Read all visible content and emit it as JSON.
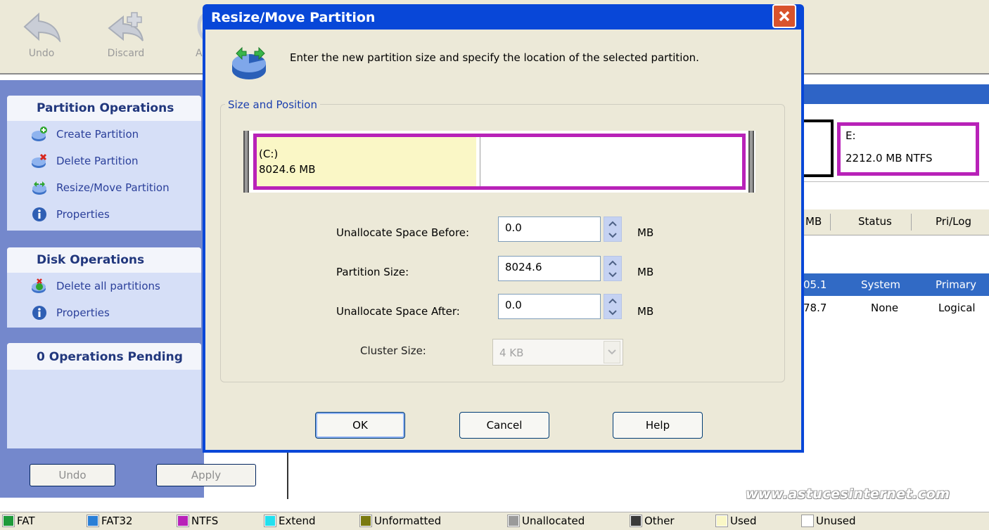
{
  "toolbar": {
    "undo": "Undo",
    "discard": "Discard",
    "apply_partial": "A"
  },
  "left_pane": {
    "partition_ops": {
      "title": "Partition Operations",
      "items": [
        "Create Partition",
        "Delete Partition",
        "Resize/Move Partition",
        "Properties"
      ]
    },
    "disk_ops": {
      "title": "Disk Operations",
      "items": [
        "Delete all partitions",
        "Properties"
      ]
    },
    "pending": {
      "title": "0 Operations Pending"
    },
    "undo_button": "Undo",
    "apply_button": "Apply"
  },
  "background_app": {
    "disk_e": {
      "letter": "E:",
      "info": "2212.0 MB  NTFS"
    },
    "columns": {
      "mb": "MB",
      "status": "Status",
      "prilog": "Pri/Log"
    },
    "rows": [
      {
        "size": "05.1",
        "status": "System",
        "type": "Primary"
      },
      {
        "size": "78.7",
        "status": "None",
        "type": "Logical"
      }
    ],
    "watermark": "www.astucesinternet.com"
  },
  "dialog": {
    "title": "Resize/Move Partition",
    "description": "Enter the new partition size and specify the location of the selected partition.",
    "group_label": "Size and Position",
    "partition": {
      "name": "(C:)",
      "size": "8024.6 MB",
      "used_fraction": 0.46
    },
    "fields": {
      "before": {
        "label": "Unallocate Space Before:",
        "value": "0.0",
        "unit": "MB"
      },
      "size": {
        "label": "Partition Size:",
        "value": "8024.6",
        "unit": "MB"
      },
      "after": {
        "label": "Unallocate Space After:",
        "value": "0.0",
        "unit": "MB"
      },
      "cluster": {
        "label": "Cluster Size:",
        "value": "4 KB"
      }
    },
    "buttons": {
      "ok": "OK",
      "cancel": "Cancel",
      "help": "Help"
    }
  },
  "legend": [
    "FAT",
    "FAT32",
    "NTFS",
    "Extend",
    "Unformatted",
    "Unallocated",
    "Other",
    "Used",
    "Unused"
  ],
  "colors": {
    "ntfs": "#b822b8",
    "fat": "#1e9a3a",
    "fat32": "#2a7fd6",
    "extend": "#22e0ee",
    "unformatted": "#7a7a10",
    "unallocated": "#9a9a9a",
    "other": "#3a3a3a",
    "used": "#faf7c6",
    "unused": "#ffffff",
    "title_bar": "#0847d8"
  }
}
